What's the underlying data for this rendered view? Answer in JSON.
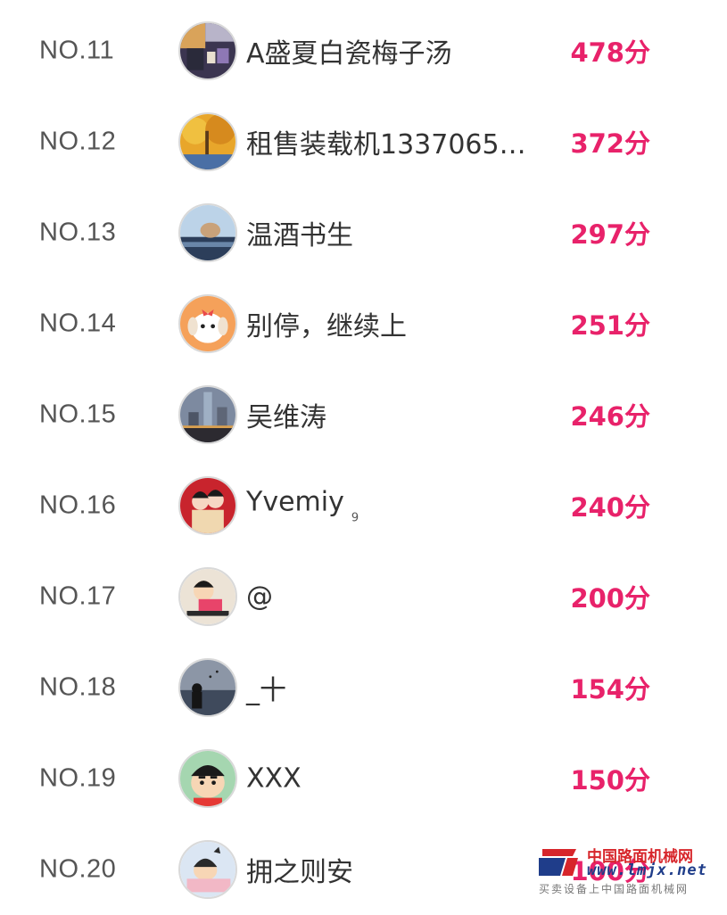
{
  "leaderboard": {
    "rows": [
      {
        "rank": "NO.11",
        "name": "A盛夏白瓷梅子汤",
        "tag": "",
        "score": "478分",
        "avatar": "collage-photo-avatar"
      },
      {
        "rank": "NO.12",
        "name": "租售装载机1337065…",
        "tag": "",
        "score": "372分",
        "avatar": "autumn-tree-avatar"
      },
      {
        "rank": "NO.13",
        "name": "温酒书生",
        "tag": "",
        "score": "297分",
        "avatar": "car-window-cat-avatar"
      },
      {
        "rank": "NO.14",
        "name": "别停，继续上",
        "tag": "",
        "score": "251分",
        "avatar": "cartoon-puppy-avatar"
      },
      {
        "rank": "NO.15",
        "name": "吴维涛",
        "tag": "",
        "score": "246分",
        "avatar": "city-skyline-avatar"
      },
      {
        "rank": "NO.16",
        "name": "Yvemiy",
        "tag": "9",
        "score": "240分",
        "avatar": "couple-illustration-avatar"
      },
      {
        "rank": "NO.17",
        "name": "@",
        "tag": "",
        "score": "200分",
        "avatar": "crayon-shinchan-avatar"
      },
      {
        "rank": "NO.18",
        "name": "_十",
        "tag": "",
        "score": "154分",
        "avatar": "night-sea-silhouette-avatar"
      },
      {
        "rank": "NO.19",
        "name": "XXX",
        "tag": "",
        "score": "150分",
        "avatar": "shinchan-face-avatar"
      },
      {
        "rank": "NO.20",
        "name": "拥之则安",
        "tag": "",
        "score": "100分",
        "avatar": "sleeping-cartoon-avatar"
      }
    ]
  },
  "watermark": {
    "cn": "中国路面机械网",
    "url": "www.lmjx.net",
    "sub": "买卖设备上中国路面机械网"
  },
  "colors": {
    "score": "#e8226a",
    "rank": "#555555",
    "name": "#333333"
  }
}
